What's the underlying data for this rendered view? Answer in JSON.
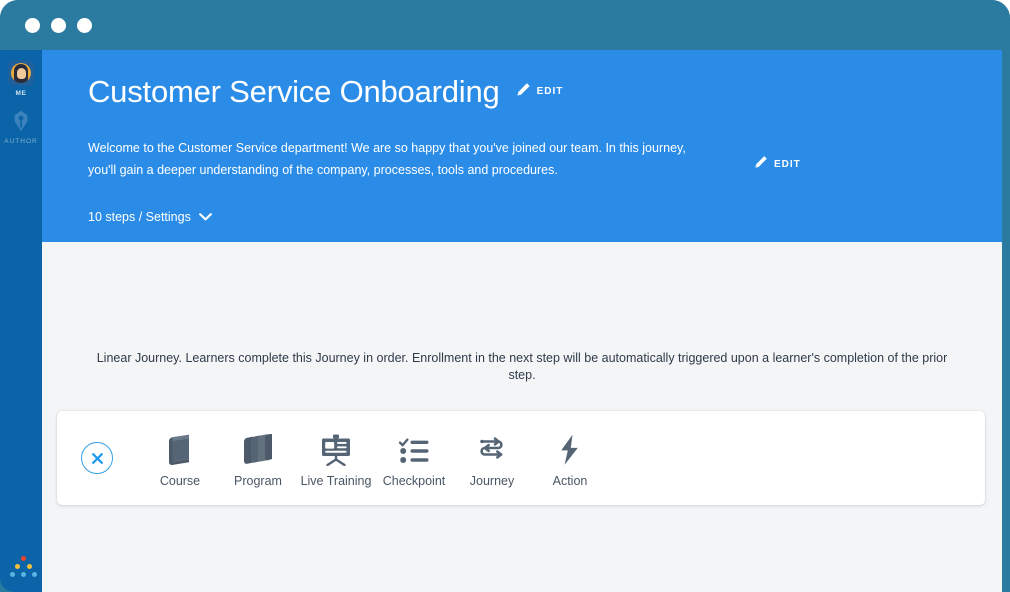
{
  "window": {
    "titlebar": {
      "dots": [
        "close-dot",
        "minimize-dot",
        "maximize-dot"
      ]
    }
  },
  "sidebar": {
    "items": [
      {
        "icon": "user-avatar-icon",
        "label": "ME"
      },
      {
        "icon": "pen-nib-icon",
        "label": "AUTHOR"
      }
    ],
    "brand_logo": "dot-pyramid-logo"
  },
  "header": {
    "title": "Customer Service Onboarding",
    "title_edit": {
      "icon": "pencil-icon",
      "label": "EDIT"
    },
    "description": "Welcome to the Customer Service department!  We are so happy that you've joined our team.  In this journey, you'll gain a deeper understanding of the company, processes, tools and procedures.",
    "description_edit": {
      "icon": "pencil-icon",
      "label": "EDIT"
    },
    "steps_settings": "10 steps / Settings",
    "steps_chevron": "chevron-down-icon"
  },
  "content": {
    "linear_note": "Linear Journey. Learners complete this Journey in order. Enrollment in the next step will be automatically triggered upon a learner's completion of the prior step.",
    "step_type_picker": {
      "close": {
        "icon": "close-circle-icon"
      },
      "types": [
        {
          "icon": "book-icon",
          "label": "Course"
        },
        {
          "icon": "books-stack-icon",
          "label": "Program"
        },
        {
          "icon": "presentation-board-icon",
          "label": "Live Training"
        },
        {
          "icon": "checklist-icon",
          "label": "Checkpoint"
        },
        {
          "icon": "winding-path-icon",
          "label": "Journey"
        },
        {
          "icon": "lightning-bolt-icon",
          "label": "Action"
        }
      ]
    }
  },
  "colors": {
    "titlebar": "#2b7ba1",
    "sidebar": "#0b64a8",
    "header_blue": "#2b8ce8",
    "content_bg": "#f4f5f7",
    "card_bg": "#ffffff",
    "accent_blue": "#35a0e8",
    "icon_slate": "#566575",
    "text_dark": "#2f3b4a"
  }
}
